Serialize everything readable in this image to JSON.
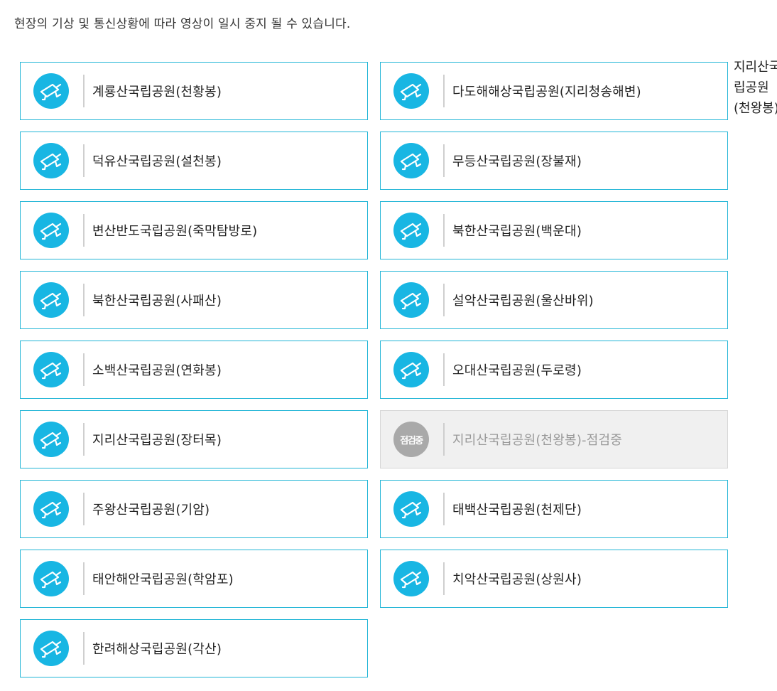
{
  "notice": "현장의 기상 및 통신상황에 따라 영상이 일시 중지 될 수 있습니다.",
  "side_label": "지리산국립공원(천왕봉)",
  "cameras": [
    {
      "label": "계룡산국립공원(천황봉)",
      "status": "live"
    },
    {
      "label": "다도해해상국립공원(지리청송해변)",
      "status": "live"
    },
    {
      "label": "덕유산국립공원(설천봉)",
      "status": "live"
    },
    {
      "label": "무등산국립공원(장불재)",
      "status": "live"
    },
    {
      "label": "변산반도국립공원(죽막탐방로)",
      "status": "live"
    },
    {
      "label": "북한산국립공원(백운대)",
      "status": "live"
    },
    {
      "label": "북한산국립공원(사패산)",
      "status": "live"
    },
    {
      "label": "설악산국립공원(울산바위)",
      "status": "live"
    },
    {
      "label": "소백산국립공원(연화봉)",
      "status": "live"
    },
    {
      "label": "오대산국립공원(두로령)",
      "status": "live"
    },
    {
      "label": "지리산국립공원(장터목)",
      "status": "live"
    },
    {
      "label": "지리산국립공원(천왕봉)-점검중",
      "status": "maintenance",
      "badge": "점검중"
    },
    {
      "label": "주왕산국립공원(기암)",
      "status": "live"
    },
    {
      "label": "태백산국립공원(천제단)",
      "status": "live"
    },
    {
      "label": "태안해안국립공원(학암포)",
      "status": "live"
    },
    {
      "label": "치악산국립공원(상원사)",
      "status": "live"
    },
    {
      "label": "한려해상국립공원(각산)",
      "status": "live"
    }
  ],
  "colors": {
    "accent": "#18b6e3",
    "border": "#21b5d6",
    "maintenance_bg": "#f0f0f0",
    "maintenance_badge": "#a9a9a9"
  },
  "icons": {
    "live": "cctv-camera-icon",
    "maintenance": "maintenance-badge"
  }
}
